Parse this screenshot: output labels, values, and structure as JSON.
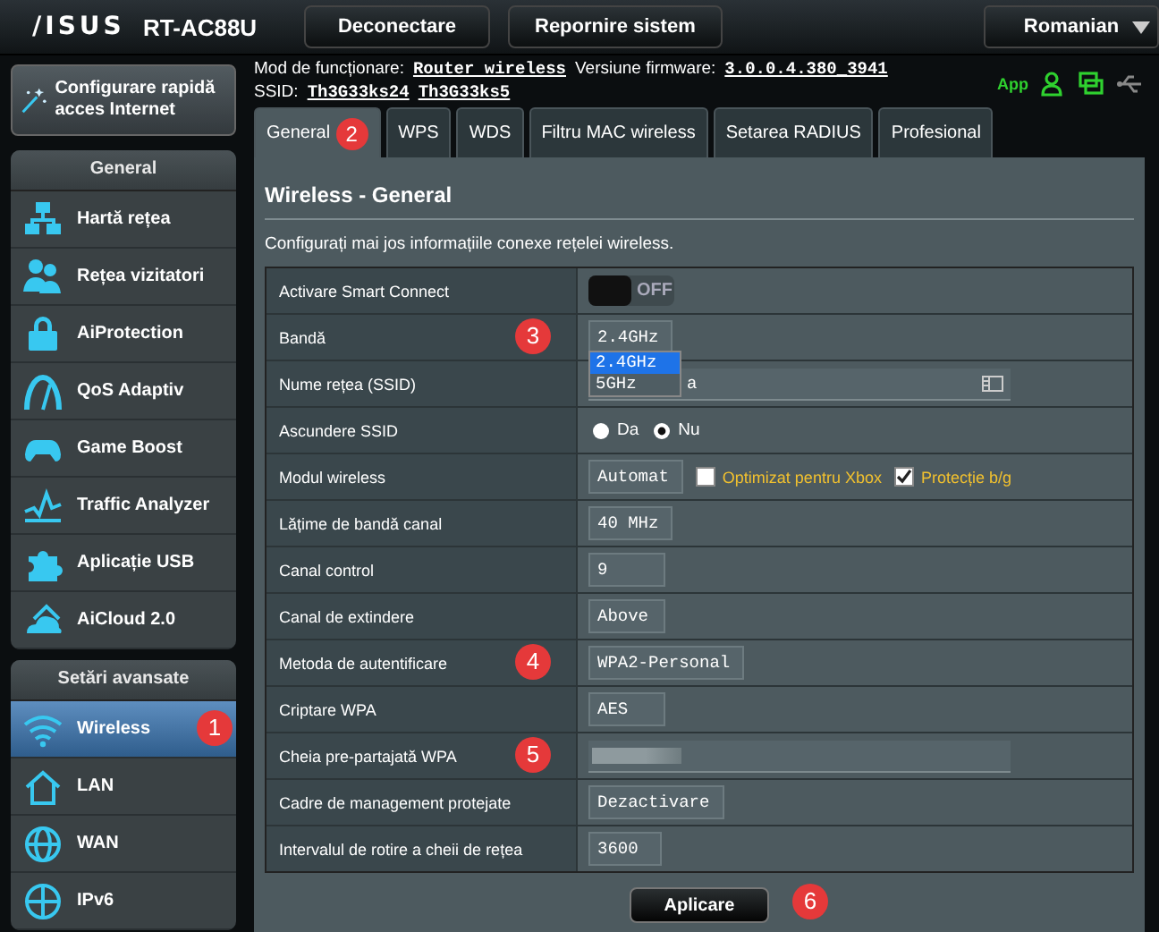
{
  "header": {
    "logo": "/ISUS",
    "model": "RT-AC88U",
    "buttons": [
      "Deconectare",
      "Repornire sistem"
    ],
    "language": "Romanian"
  },
  "info": {
    "mode_label": "Mod de funcționare:",
    "mode_value": "Router wireless",
    "firmware_label": "Versiune firmware:",
    "firmware_value": "3.0.0.4.380_3941",
    "ssid_label": "SSID:",
    "ssids": [
      "Th3G33ks24",
      "Th3G33ks5"
    ],
    "app_label": "App"
  },
  "quick_setup": "Configurare rapidă acces Internet",
  "sidebar": [
    {
      "title": "General",
      "items": [
        {
          "label": "Hartă rețea",
          "selected": false
        },
        {
          "label": "Rețea vizitatori",
          "selected": false
        },
        {
          "label": "AiProtection",
          "selected": false
        },
        {
          "label": "QoS Adaptiv",
          "selected": false
        },
        {
          "label": "Game Boost",
          "selected": false
        },
        {
          "label": "Traffic Analyzer",
          "selected": false
        },
        {
          "label": "Aplicație USB",
          "selected": false
        },
        {
          "label": "AiCloud 2.0",
          "selected": false
        }
      ]
    },
    {
      "title": "Setări avansate",
      "items": [
        {
          "label": "Wireless",
          "selected": true,
          "callout": "1"
        },
        {
          "label": "LAN",
          "selected": false
        },
        {
          "label": "WAN",
          "selected": false
        },
        {
          "label": "IPv6",
          "selected": false
        }
      ]
    }
  ],
  "tabs": [
    {
      "label": "General",
      "selected": true,
      "callout": "2"
    },
    {
      "label": "WPS",
      "selected": false
    },
    {
      "label": "WDS",
      "selected": false
    },
    {
      "label": "Filtru MAC wireless",
      "selected": false
    },
    {
      "label": "Setarea RADIUS",
      "selected": false
    },
    {
      "label": "Profesional",
      "selected": false
    }
  ],
  "page_title": "Wireless - General",
  "description": "Configurați mai jos informațiile conexe rețelei wireless.",
  "rows": [
    {
      "label": "Activare Smart Connect",
      "kind": "toggle",
      "on": false,
      "value": "OFF"
    },
    {
      "label": "Bandă",
      "kind": "select",
      "value": "2.4GHz",
      "callout": "3",
      "expanded": true,
      "options": [
        {
          "label": "2.4GHz",
          "selected": true
        },
        {
          "label": "5GHz",
          "selected": false
        }
      ]
    },
    {
      "label": "Nume rețea (SSID)",
      "kind": "text",
      "value": "a"
    },
    {
      "label": "Ascundere SSID",
      "kind": "radio",
      "options": [
        {
          "label": "Da",
          "selected": false
        },
        {
          "label": "Nu",
          "selected": true
        }
      ]
    },
    {
      "label": "Modul wireless",
      "kind": "select",
      "value": "Automat",
      "checks": [
        {
          "label": "Optimizat pentru Xbox",
          "checked": false
        },
        {
          "label": "Protecție b/g",
          "checked": true
        }
      ]
    },
    {
      "label": "Lățime de bandă canal",
      "kind": "select",
      "value": "40 MHz"
    },
    {
      "label": "Canal control",
      "kind": "select",
      "value": "9"
    },
    {
      "label": "Canal de extindere",
      "kind": "select",
      "value": "Above"
    },
    {
      "label": "Metoda de autentificare",
      "kind": "select",
      "value": "WPA2-Personal",
      "callout": "4"
    },
    {
      "label": "Criptare WPA",
      "kind": "select",
      "value": "AES"
    },
    {
      "label": "Cheia pre-partajată WPA",
      "kind": "secret",
      "callout": "5"
    },
    {
      "label": "Cadre de management protejate",
      "kind": "select",
      "value": "Dezactivare"
    },
    {
      "label": "Intervalul de rotire a cheii de rețea",
      "kind": "input",
      "value": "3600"
    }
  ],
  "apply": {
    "label": "Aplicare",
    "callout": "6"
  }
}
